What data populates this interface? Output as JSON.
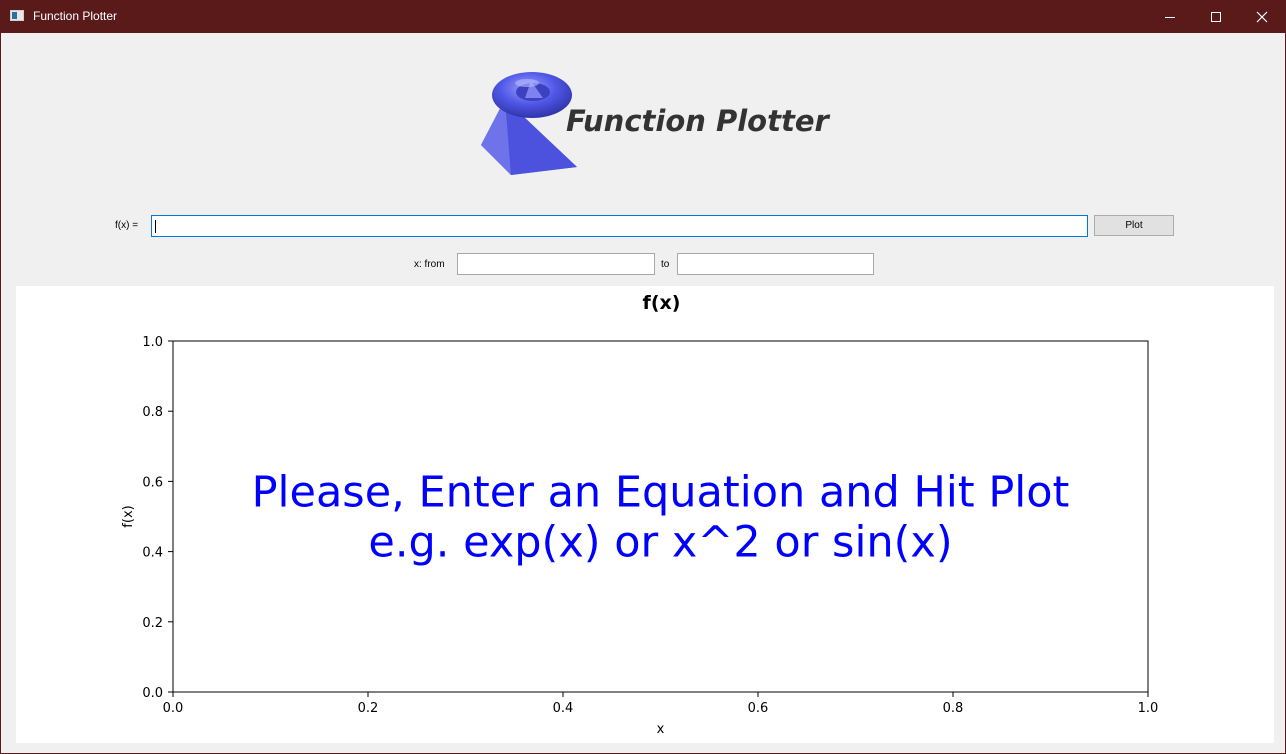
{
  "window": {
    "title": "Function Plotter",
    "controls": {
      "minimize": "minimize-icon",
      "maximize": "maximize-icon",
      "close": "close-icon"
    }
  },
  "header": {
    "logo_icon": "function-plotter-logo-icon",
    "logo_text": "Function Plotter"
  },
  "form": {
    "fx_label": "f(x) =",
    "fx_value": "",
    "plot_button": "Plot",
    "x_from_label": "x: from",
    "x_from_value": "",
    "x_to_label": "to",
    "x_to_value": ""
  },
  "chart_data": {
    "type": "line",
    "title": "f(x)",
    "xlabel": "x",
    "ylabel": "f(x)",
    "xlim": [
      0.0,
      1.0
    ],
    "ylim": [
      0.0,
      1.0
    ],
    "x_ticks": [
      "0.0",
      "0.2",
      "0.4",
      "0.6",
      "0.8",
      "1.0"
    ],
    "y_ticks": [
      "0.0",
      "0.2",
      "0.4",
      "0.6",
      "0.8",
      "1.0"
    ],
    "series": [],
    "grid": false,
    "annotations": [
      "Please, Enter an Equation and Hit Plot",
      "e.g. exp(x) or x^2 or sin(x)"
    ],
    "annotation_color": "#0000ff"
  }
}
